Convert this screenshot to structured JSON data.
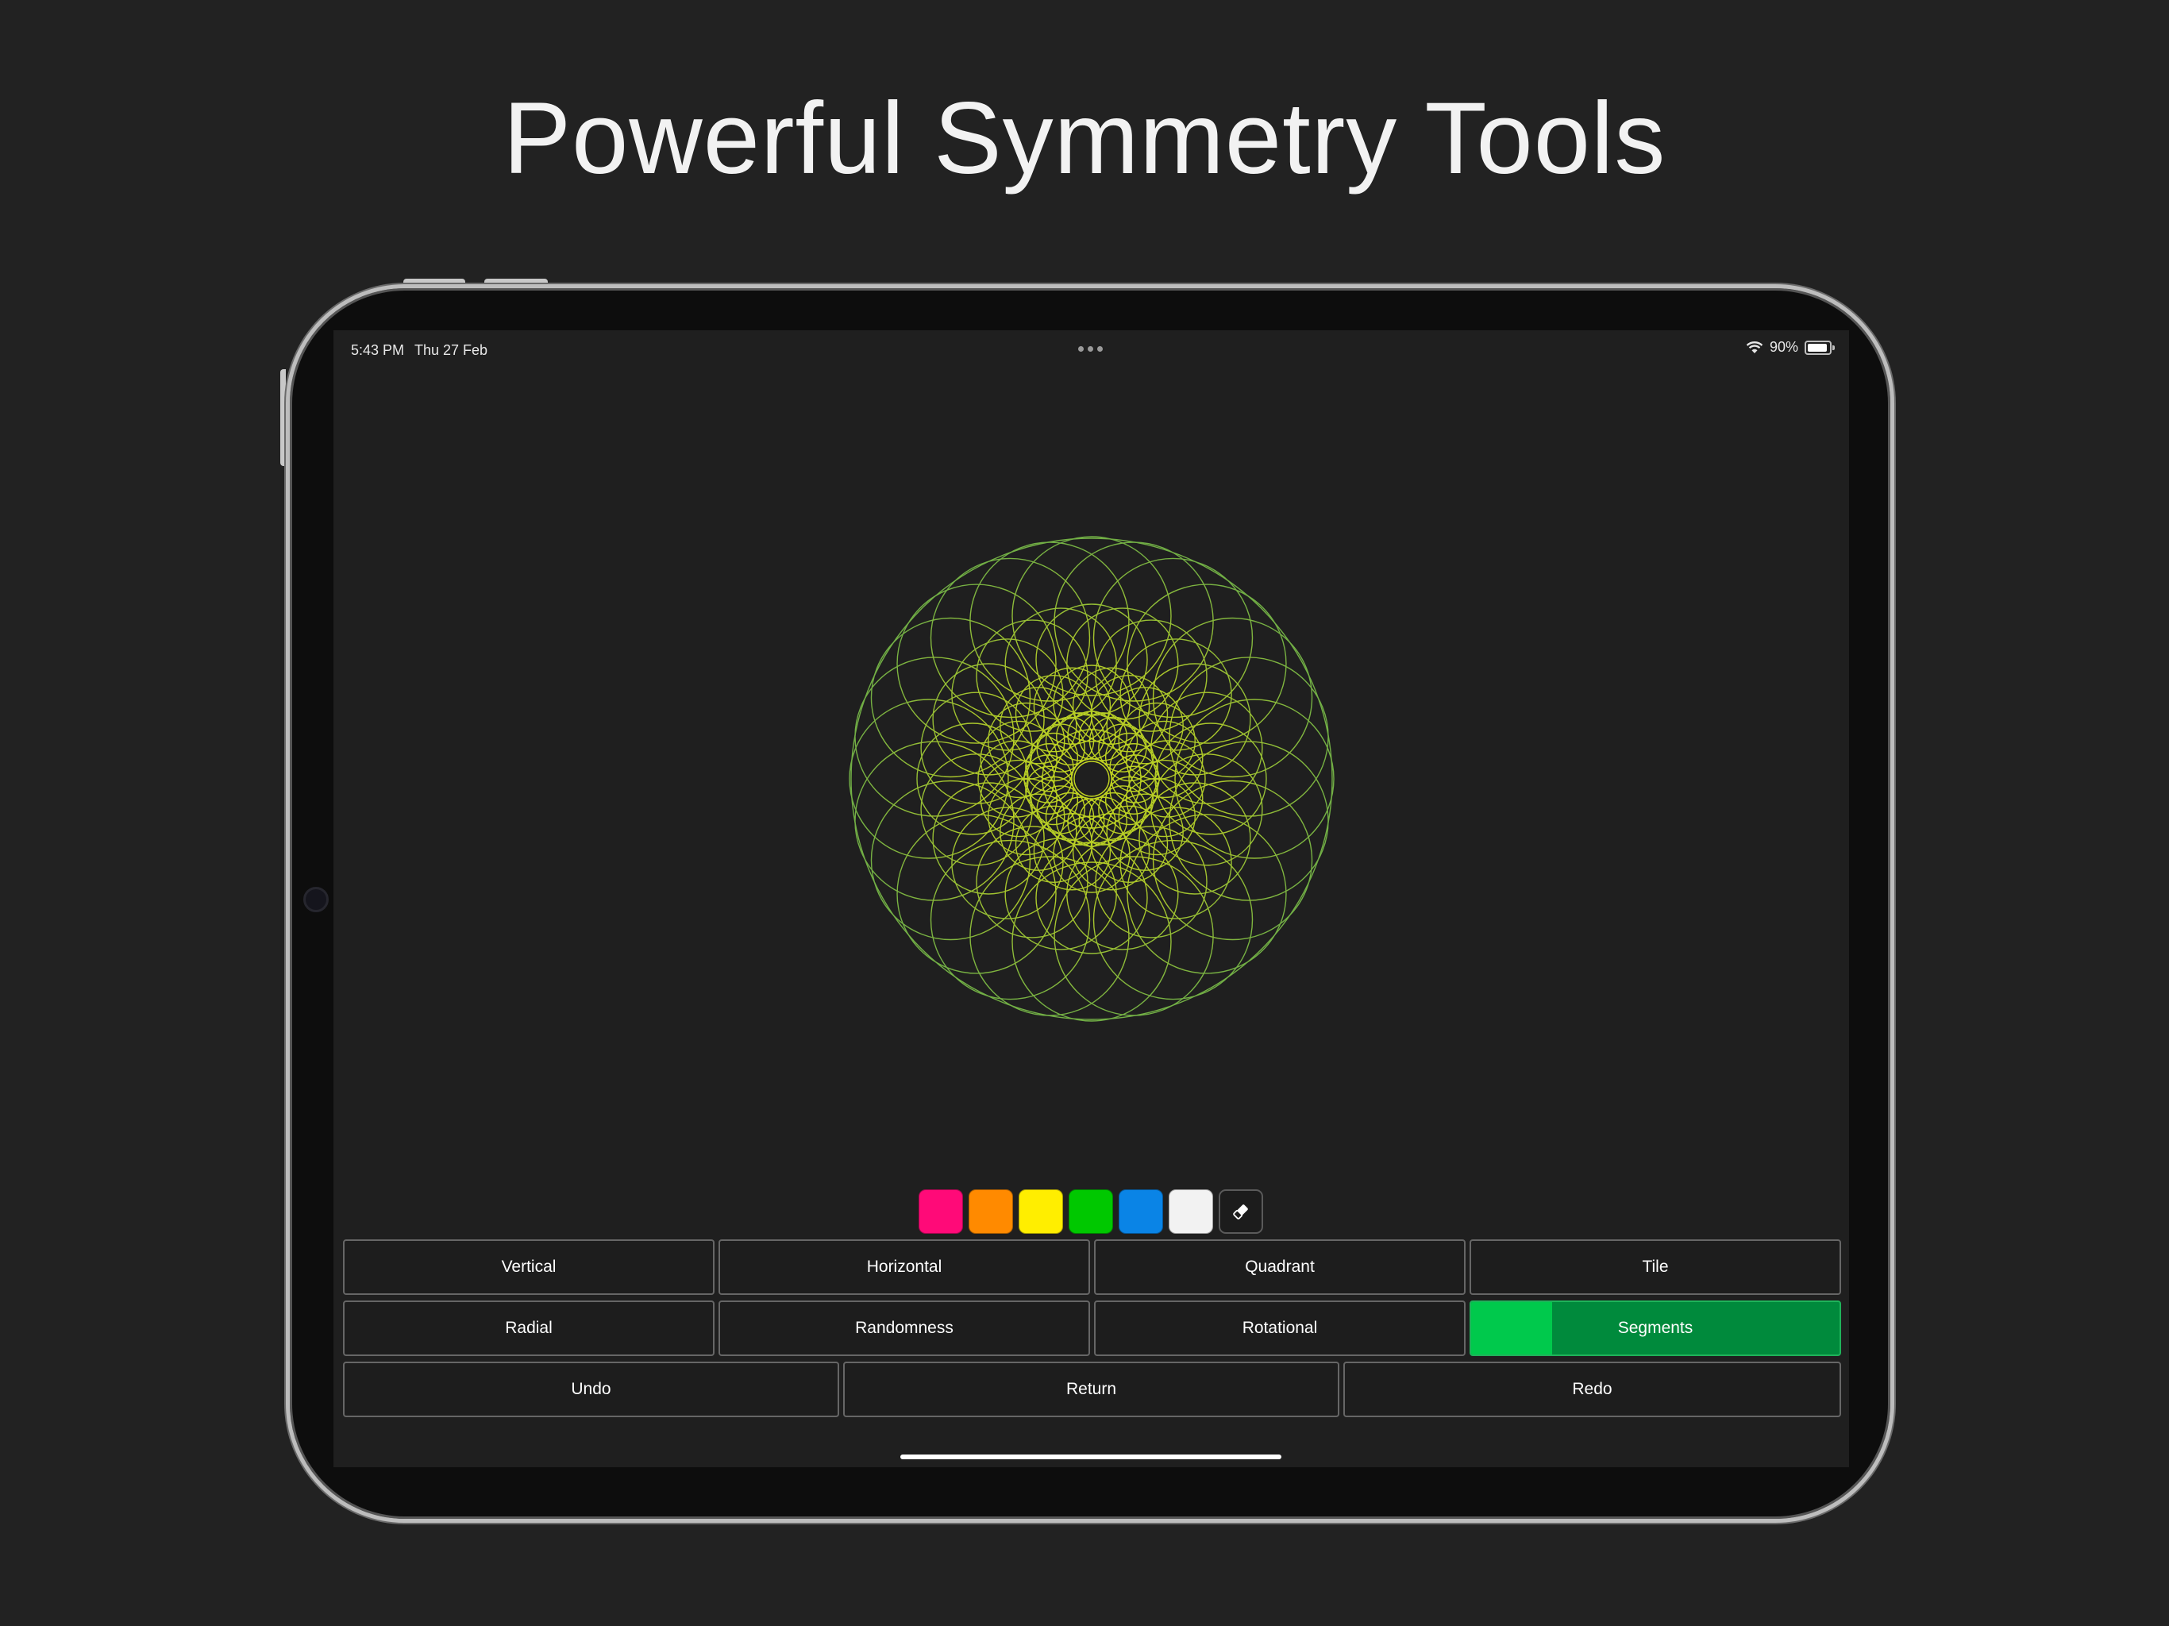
{
  "headline": "Powerful Symmetry Tools",
  "status_bar": {
    "time": "5:43 PM",
    "date": "Thu 27 Feb",
    "battery": "90%",
    "battery_level": 0.9
  },
  "canvas": {
    "drawing": "green mandala",
    "stroke_color_inner": "#c6d71f",
    "stroke_color_outer": "#6fae46"
  },
  "palette": [
    {
      "name": "pink",
      "color": "#ff0a78"
    },
    {
      "name": "orange",
      "color": "#ff8a00"
    },
    {
      "name": "yellow",
      "color": "#ffee00"
    },
    {
      "name": "green",
      "color": "#00c800"
    },
    {
      "name": "blue",
      "color": "#0a84e6"
    },
    {
      "name": "white",
      "color": "#f2f2f2"
    }
  ],
  "eraser_icon": "eraser-icon",
  "buttons": {
    "vertical": "Vertical",
    "horizontal": "Horizontal",
    "quadrant": "Quadrant",
    "tile": "Tile",
    "radial": "Radial",
    "randomness": "Randomness",
    "rotational": "Rotational",
    "segments": "Segments",
    "undo": "Undo",
    "return": "Return",
    "redo": "Redo"
  },
  "segments_level": 0.22,
  "colors": {
    "background": "#222222",
    "screen": "#1f1f1f",
    "active_button": "#008a3c",
    "active_fill": "#00c94c"
  }
}
